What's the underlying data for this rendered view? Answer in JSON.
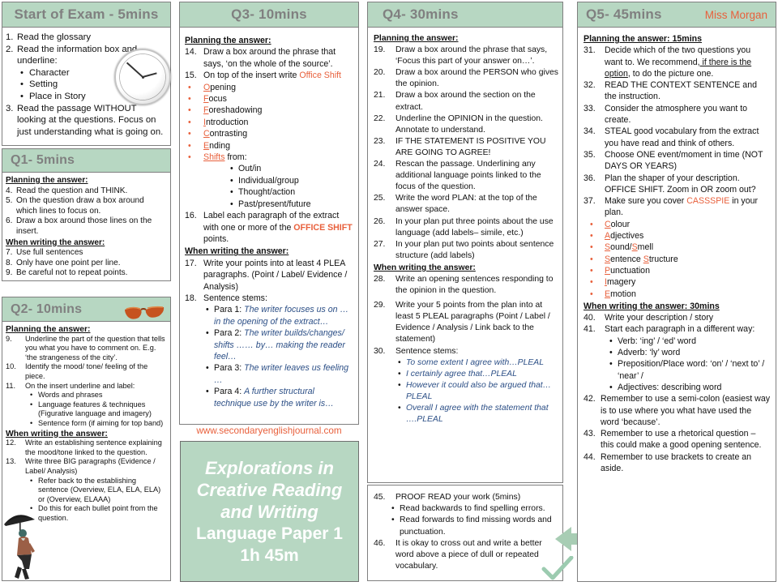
{
  "meta": {
    "teacher": "Miss Morgan",
    "website": "www.secondaryenglishjournal.com",
    "accent_orange": "#e8603c",
    "header_green": "#b7d7c2",
    "header_text": "#808080",
    "stem_blue": "#2c4f86"
  },
  "title_box": {
    "line1": "Explorations in",
    "line2": "Creative Reading",
    "line3": "and Writing",
    "line4": "Language Paper 1",
    "line5": "1h 45m"
  },
  "labels": {
    "planning": "Planning the answer:",
    "writing": "When writing the answer:"
  },
  "start": {
    "header": "Start of Exam  - 5mins",
    "items": [
      {
        "n": "1.",
        "t": "Read the glossary"
      },
      {
        "n": "2.",
        "t": "Read the information box and underline:"
      },
      {
        "n": "3.",
        "t": "Read the passage WITHOUT looking at the questions. Focus on just understanding what is going on."
      }
    ],
    "bullets": [
      "Character",
      "Setting",
      "Place in Story"
    ]
  },
  "q1": {
    "header": "Q1- 5mins",
    "planning": [
      {
        "n": "4.",
        "t": "Read the question and THINK."
      },
      {
        "n": "5.",
        "t": "On the question draw a box around which lines to focus on."
      },
      {
        "n": "6.",
        "t": "Draw a box around those lines on the insert."
      }
    ],
    "writing": [
      {
        "n": "7.",
        "t": "Use full sentences"
      },
      {
        "n": "8.",
        "t": "Only have one point per line."
      },
      {
        "n": "9.",
        "t": "Be careful not to repeat points."
      }
    ]
  },
  "q2": {
    "header": "Q2- 10mins",
    "planning": [
      {
        "n": "9.",
        "t": "Underline the part of the question that tells you what you have to comment on. E.g. ‘the strangeness of the city’."
      },
      {
        "n": "10.",
        "t": "Identify the mood/ tone/ feeling of the piece."
      },
      {
        "n": "11.",
        "t": "On the insert underline and label:"
      }
    ],
    "planning_bullets": [
      "Words and phrases",
      "Language features & techniques (Figurative language and imagery)",
      "Sentence form (if aiming for top band)"
    ],
    "writing": [
      {
        "n": "12.",
        "t": "Write an establishing sentence explaining the mood/tone linked to the question."
      },
      {
        "n": "13.",
        "t": "Write three BIG paragraphs (Evidence / Label/ Analysis)"
      }
    ],
    "writing_bullets": [
      "Refer back to the establishing sentence (Overview, ELA, ELA, ELA) or (Overview, ELAAA)",
      "Do this for each bullet point from the question."
    ]
  },
  "q3": {
    "header": "Q3- 10mins",
    "item14_n": "14.",
    "item14_t": "Draw a box around the phrase that says, ‘on the whole of the source’.",
    "item15_n": "15.",
    "item15_pre": "On top of the insert write ",
    "item15_key": "Office Shift",
    "acrostic": [
      {
        "letter": "O",
        "rest": "pening"
      },
      {
        "letter": "F",
        "rest": "ocus"
      },
      {
        "letter": "F",
        "rest": "oreshadowing"
      },
      {
        "letter": "I",
        "rest": "ntroduction"
      },
      {
        "letter": "C",
        "rest": "ontrasting"
      },
      {
        "letter": "E",
        "rest": "nding"
      }
    ],
    "shifts_word": "Shifts",
    "shifts_suffix": " from:",
    "shifts": [
      "Out/in",
      "Individual/group",
      "Thought/action",
      "Past/present/future"
    ],
    "item16_n": "16.",
    "item16_a": "Label each paragraph of the extract with one or more of the ",
    "item16_key": "OFFICE SHIFT",
    "item16_b": " points.",
    "writing": [
      {
        "n": "17.",
        "t": "Write your points into at least 4 PLEA paragraphs. (Point / Label/ Evidence / Analysis)"
      },
      {
        "n": "18.",
        "t": "Sentence stems:"
      }
    ],
    "stems": [
      {
        "label": "Para 1: ",
        "text": "The writer focuses us on … in the opening of the extract…"
      },
      {
        "label": "Para 2: ",
        "text": "The writer builds/changes/ shifts  …… by… making the reader feel…"
      },
      {
        "label": "Para 3: ",
        "text": "The writer leaves us feeling …"
      },
      {
        "label": "Para 4: ",
        "text": "A further structural technique use by the writer is…"
      }
    ]
  },
  "q4": {
    "header": "Q4- 30mins",
    "planning": [
      {
        "n": "19.",
        "t": "Draw a box around the phrase that says, ‘Focus this part of your answer on…’."
      },
      {
        "n": "20.",
        "t": "Draw a box around the PERSON who gives the opinion."
      },
      {
        "n": "21.",
        "t": "Draw a box around the section on the extract."
      },
      {
        "n": "22.",
        "t": "Underline the OPINION in the question. Annotate to understand."
      },
      {
        "n": "23.",
        "t": "IF THE STATEMENT IS POSITIVE YOU ARE GOING TO AGREE!"
      },
      {
        "n": "24.",
        "t": "Rescan the passage. Underlining any additional language points linked to the focus of the question."
      },
      {
        "n": "25.",
        "t": "Write the word PLAN: at the top of the answer space."
      },
      {
        "n": "26.",
        "t": "In your plan put three points about the use language (add labels– simile, etc.)"
      },
      {
        "n": "27.",
        "t": "In your plan put two points about sentence structure (add labels)"
      }
    ],
    "writing": [
      {
        "n": "28.",
        "t": "Write an opening sentences responding to the opinion in the question."
      },
      {
        "n": "29.",
        "t": "Write your 5 points from the plan into at least 5 PLEAL paragraphs (Point / Label / Evidence / Analysis / Link back to the statement)"
      },
      {
        "n": "30.",
        "t": "Sentence stems:"
      }
    ],
    "stems": [
      "To some extent I agree with…PLEAL",
      "I certainly agree that…PLEAL",
      "However it could also be argued that…PLEAL",
      "Overall I agree with the statement that ….PLEAL"
    ]
  },
  "proof": {
    "items": [
      {
        "n": "45.",
        "t": "PROOF READ your work (5mins)"
      },
      {
        "n": "46.",
        "t": "It is okay to cross out and write a better  word above a piece of dull or repeated vocabulary."
      }
    ],
    "bullets": [
      "Read backwards to find spelling errors.",
      "Read forwards to find missing words and punctuation."
    ]
  },
  "q5": {
    "header": "Q5- 45mins",
    "planning_time": " 15mins",
    "writing_time": " 30mins",
    "planning": [
      {
        "n": "31.",
        "t_a": "Decide which of the two questions you want to. We recommend",
        "t_u": ", if there is the option",
        "t_b": ", to do the picture one."
      },
      {
        "n": "32.",
        "t": "READ THE CONTEXT SENTENCE and the instruction."
      },
      {
        "n": "33.",
        "t": "Consider the atmosphere you want to create."
      },
      {
        "n": "34.",
        "t": "STEAL good vocabulary from the extract you have read and think of others."
      },
      {
        "n": "35.",
        "t": "Choose ONE event/moment  in time (NOT DAYS OR YEARS)"
      },
      {
        "n": "36.",
        "t": "Plan the shaper of your description. OFFICE SHIFT. Zoom  in OR zoom  out?"
      }
    ],
    "item37_n": "37.",
    "item37_a": "Make sure you cover ",
    "item37_key": "CASSSPIE",
    "item37_b": " in your plan.",
    "acrostic": [
      {
        "letter": "C",
        "rest": "olour"
      },
      {
        "letter": "A",
        "rest": "djectives"
      },
      {
        "letter": "S",
        "rest": "ound/",
        "letter2": "S",
        "rest2": "mell"
      },
      {
        "letter": "S",
        "rest": "entence ",
        "letter2": "S",
        "rest2": "tructure"
      },
      {
        "letter": "P",
        "rest": "unctuation"
      },
      {
        "letter": "I",
        "rest": "magery"
      },
      {
        "letter": "E",
        "rest": "motion"
      }
    ],
    "writing": [
      {
        "n": "40.",
        "t": "Write your description / story"
      },
      {
        "n": "41.",
        "t": "Start each paragraph in a different way:"
      }
    ],
    "writing_bullets": [
      "Verb: ‘ing’ / ‘ed’  word",
      "Adverb: ‘ly’ word",
      "Preposition/Place word: ‘on’ / ‘next to’ / ‘near’ /",
      "Adjectives: describing word"
    ],
    "writing_tail": [
      {
        "n": "42.",
        "t": "Remember  to use a semi-colon (easiest way is to use where you what have used the word ‘because’."
      },
      {
        "n": "43.",
        "t": "Remember  to use a rhetorical question – this could make a good opening sentence."
      },
      {
        "n": "44.",
        "t": "Remember  to use brackets to create an aside."
      }
    ]
  }
}
